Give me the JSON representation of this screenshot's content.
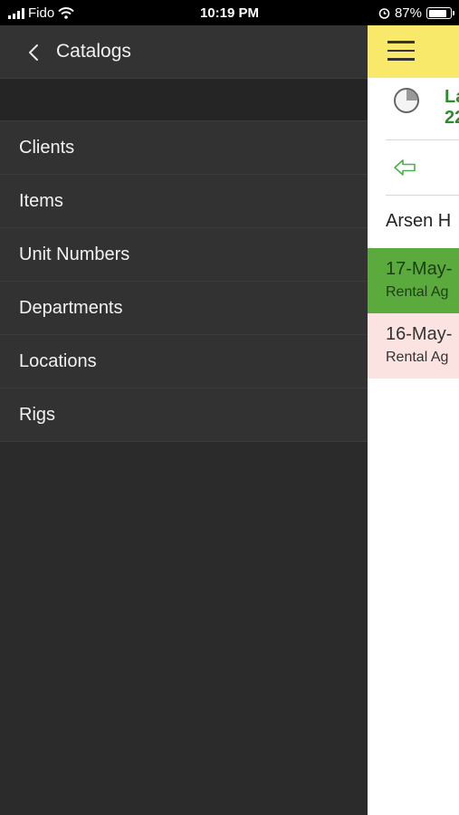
{
  "status_bar": {
    "carrier": "Fido",
    "time": "10:19 PM",
    "battery": "87%",
    "battery_level": 0.87
  },
  "drawer": {
    "title": "Catalogs",
    "items": [
      {
        "label": "Clients"
      },
      {
        "label": "Items"
      },
      {
        "label": "Unit Numbers"
      },
      {
        "label": "Departments"
      },
      {
        "label": "Locations"
      },
      {
        "label": "Rigs"
      }
    ]
  },
  "content": {
    "info_line1": "La",
    "info_line2": "22",
    "name": "Arsen H",
    "entries": [
      {
        "date": "17-May-",
        "subtitle": "Rental Ag",
        "status_color": "#5aaa3e"
      },
      {
        "date": "16-May-",
        "subtitle": "Rental Ag",
        "status_color": "#fbe3e1"
      }
    ]
  },
  "colors": {
    "drawer_bg": "#2b2b2b",
    "header_accent": "#f9e96a",
    "info_text": "#2e8b2e"
  },
  "icons": [
    "signal-icon",
    "wifi-icon",
    "alarm-icon",
    "battery-icon",
    "back-chevron-icon",
    "hamburger-icon",
    "clock-icon",
    "back-arrow-icon"
  ]
}
